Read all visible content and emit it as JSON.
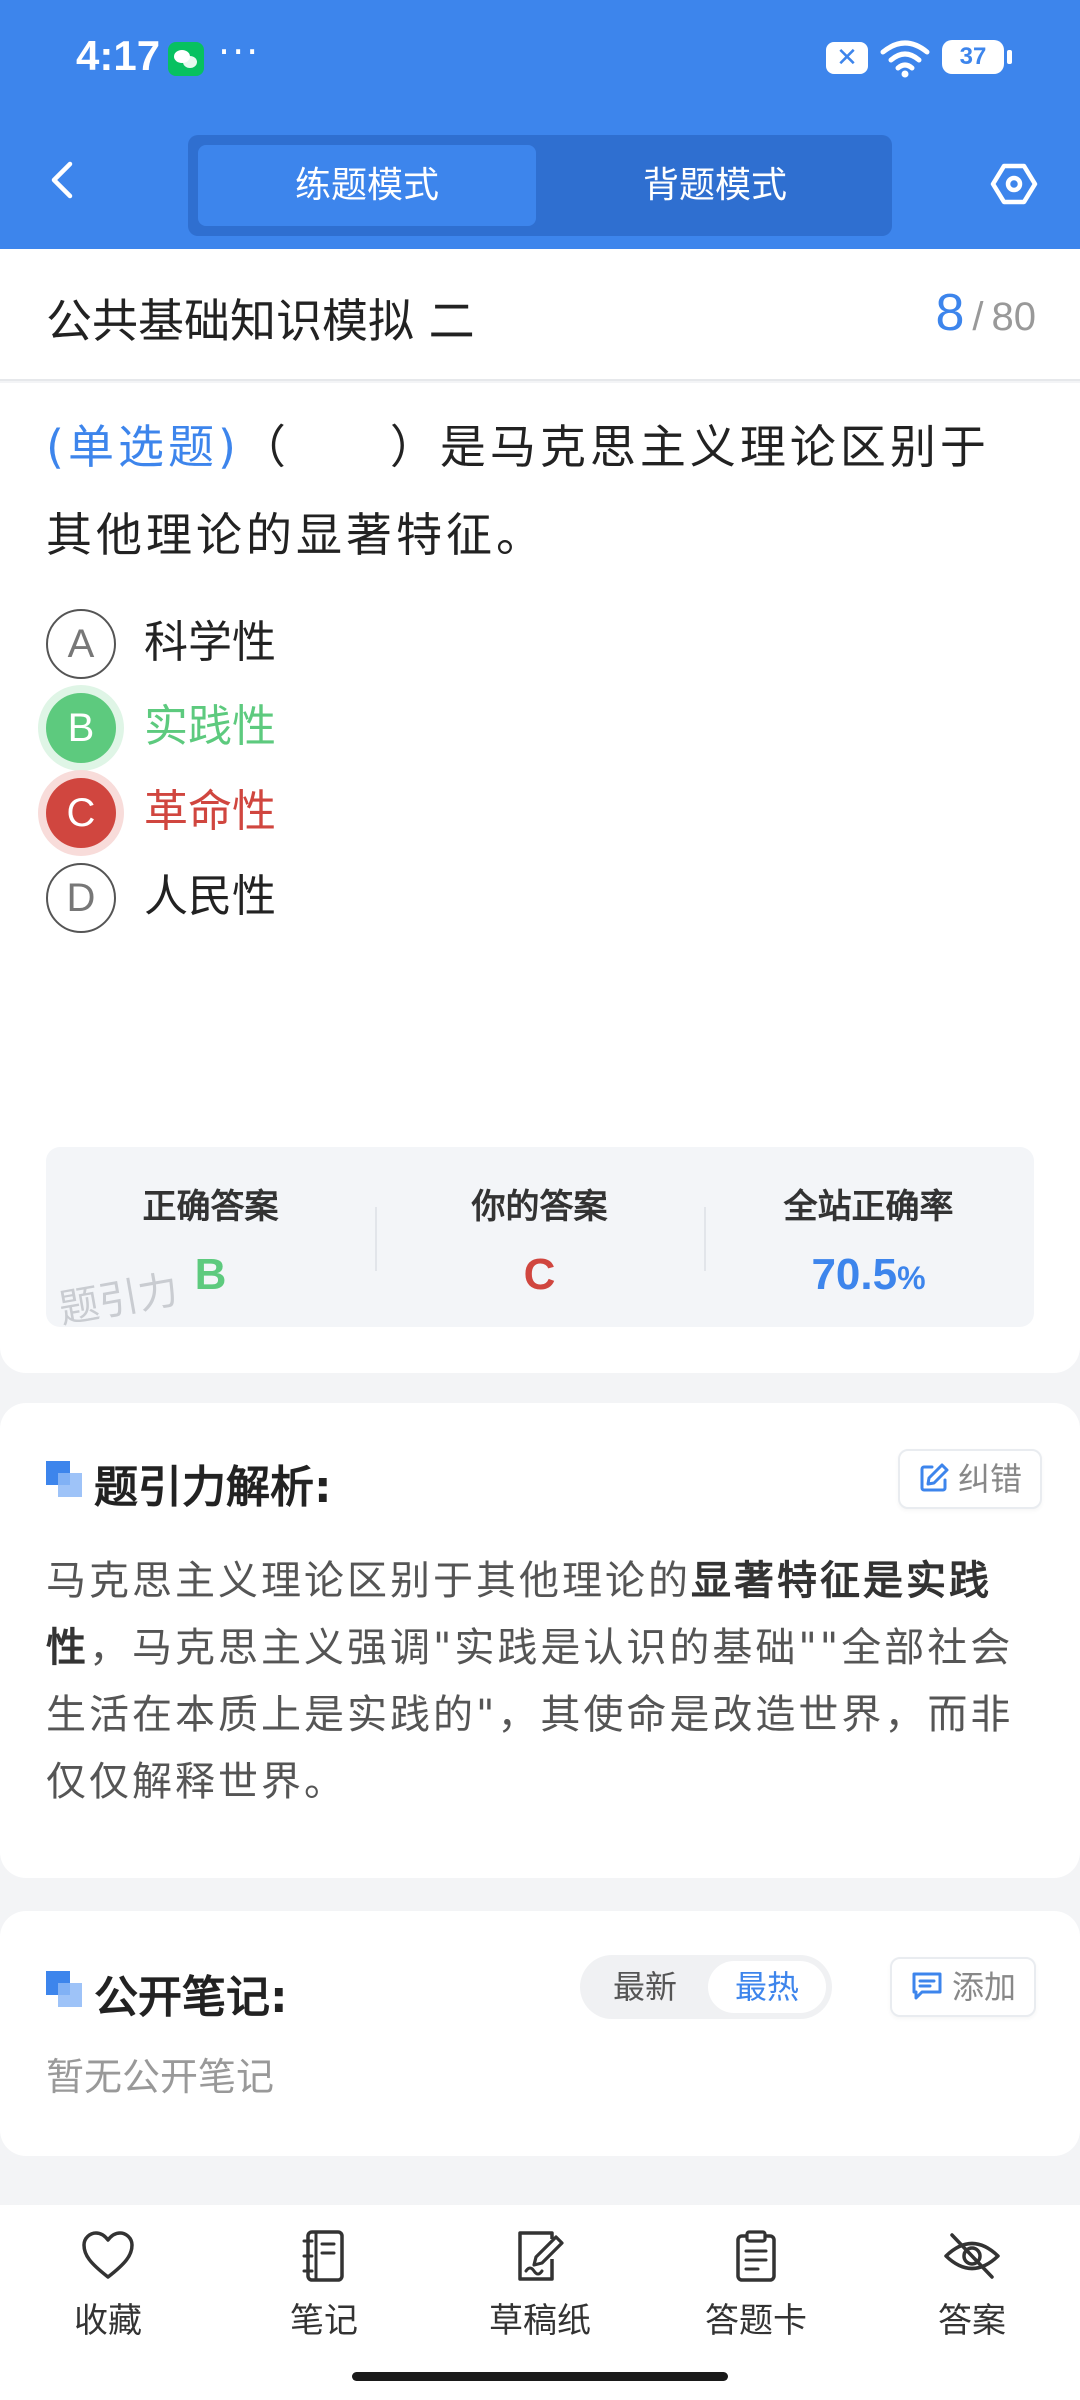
{
  "status_bar": {
    "time": "4:17",
    "dots": "···",
    "battery": "37"
  },
  "header": {
    "mode_tabs": [
      "练题模式",
      "背题模式"
    ],
    "active_tab": 0,
    "accent_color": "#3d85ec"
  },
  "title_row": {
    "title": "公共基础知识模拟 二",
    "current": "8",
    "separator": "/",
    "total": "80"
  },
  "question": {
    "type_label": "(单选题)",
    "text": "（　　）是马克思主义理论区别于其他理论的显著特征。",
    "options": [
      {
        "letter": "A",
        "text": "科学性",
        "state": "normal"
      },
      {
        "letter": "B",
        "text": "实践性",
        "state": "correct"
      },
      {
        "letter": "C",
        "text": "革命性",
        "state": "wrong"
      },
      {
        "letter": "D",
        "text": "人民性",
        "state": "normal"
      }
    ]
  },
  "answer_summary": {
    "correct_label": "正确答案",
    "correct_value": "B",
    "yours_label": "你的答案",
    "yours_value": "C",
    "rate_label": "全站正确率",
    "rate_value": "70.5",
    "rate_unit": "%",
    "watermark": "题引力"
  },
  "analysis": {
    "title": "题引力解析:",
    "correct_button": "纠错",
    "text_before": "马克思主义理论区别于其他理论的",
    "text_bold": "显著特征是实践性",
    "text_after": "，马克思主义强调\"实践是认识的基础\"\"全部社会生活在本质上是实践的\"，其使命是改造世界，而非仅仅解释世界。"
  },
  "notes": {
    "title": "公开笔记:",
    "sort_options": [
      "最新",
      "最热"
    ],
    "add_button": "添加",
    "empty_text": "暂无公开笔记"
  },
  "bottom_nav": [
    {
      "label": "收藏",
      "icon": "heart-icon"
    },
    {
      "label": "笔记",
      "icon": "notebook-icon"
    },
    {
      "label": "草稿纸",
      "icon": "draft-icon"
    },
    {
      "label": "答题卡",
      "icon": "answer-card-icon"
    },
    {
      "label": "答案",
      "icon": "eye-off-icon"
    }
  ],
  "colors": {
    "correct": "#5dca7e",
    "wrong": "#d0463f",
    "accent": "#3d85ec"
  }
}
